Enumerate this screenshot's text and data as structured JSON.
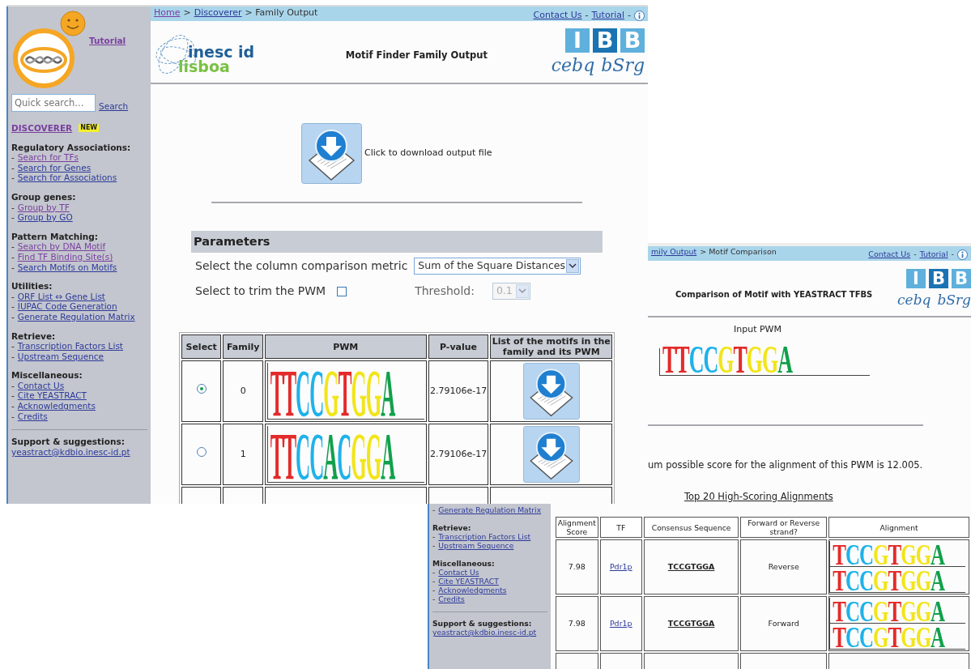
{
  "main_window": {
    "sidebar": {
      "tutorial_link": {
        "label": "Tutorial",
        "visited": true
      },
      "quick_search": {
        "placeholder": "Quick search...",
        "button": "Search"
      },
      "discoverer": {
        "label": "DISCOVERER",
        "visited": true,
        "badge": "NEW"
      },
      "sections": [
        {
          "heading": "Regulatory Associations:",
          "links": [
            {
              "bullet": "-",
              "label": "Search for TFs",
              "visited": true
            },
            {
              "bullet": "-",
              "label": "Search for Genes",
              "visited": false
            },
            {
              "bullet": "-",
              "label": "Search for Associations",
              "visited": false
            }
          ]
        },
        {
          "heading": "Group genes:",
          "links": [
            {
              "bullet": "-",
              "label": "Group by TF",
              "visited": true
            },
            {
              "bullet": "-",
              "label": "Group by GO",
              "visited": false
            }
          ]
        },
        {
          "heading": "Pattern Matching:",
          "links": [
            {
              "bullet": "-",
              "label": "Search by DNA Motif",
              "visited": true
            },
            {
              "bullet": "-",
              "label": "Find TF Binding Site(s)",
              "visited": true
            },
            {
              "bullet": "-",
              "label": "Search Motifs on Motifs",
              "visited": false
            }
          ]
        },
        {
          "heading": "Utilities:",
          "links": [
            {
              "bullet": "-",
              "label": "ORF List ⇔ Gene List",
              "visited": false
            },
            {
              "bullet": "-",
              "label": "IUPAC Code Generation",
              "visited": false
            },
            {
              "bullet": "-",
              "label": "Generate Regulation Matrix",
              "visited": false
            }
          ]
        },
        {
          "heading": "Retrieve:",
          "links": [
            {
              "bullet": "-",
              "label": "Transcription Factors List",
              "visited": false
            },
            {
              "bullet": "-",
              "label": "Upstream Sequence",
              "visited": false
            }
          ]
        },
        {
          "heading": "Miscellaneous:",
          "links": [
            {
              "bullet": "-",
              "label": "Contact Us",
              "visited": false
            },
            {
              "bullet": "-",
              "label": "Cite YEASTRACT",
              "visited": false
            },
            {
              "bullet": "-",
              "label": "Acknowledgments",
              "visited": false
            },
            {
              "bullet": "-",
              "label": "Credits",
              "visited": false
            }
          ]
        }
      ],
      "support": {
        "heading": "Support & suggestions:",
        "email": "yeastract@kdbio.inesc-id.pt"
      }
    },
    "nav_bar": {
      "breadcrumb": [
        {
          "kind": "link",
          "label": "Home",
          "visited": true
        },
        {
          "kind": "text",
          "label": ">"
        },
        {
          "kind": "link",
          "label": "Discoverer",
          "visited": false
        },
        {
          "kind": "text",
          "label": "> Family Output"
        }
      ],
      "links": [
        {
          "kind": "link",
          "label": "Contact Us",
          "visited": false
        },
        {
          "kind": "text",
          "label": "-"
        },
        {
          "kind": "link",
          "label": "Tutorial",
          "visited": false
        },
        {
          "kind": "text",
          "label": "-"
        },
        {
          "kind": "info"
        }
      ]
    },
    "header": {
      "inesc_logo": [
        "inesc id",
        "lisboa"
      ],
      "title": "Motif Finder Family Output",
      "ibb_logo": {
        "tiles": [
          "I",
          "B",
          "B"
        ],
        "words": [
          "cebq",
          "bSrg"
        ]
      }
    },
    "download": {
      "label": "Click to download output file"
    },
    "parameters": {
      "heading": "Parameters",
      "metric_label": "Select the column comparison metric",
      "metric_value": "Sum of the Square Distances",
      "trim_label": "Select to trim the PWM",
      "trim_checked": false,
      "threshold_label": "Threshold:",
      "threshold_value": "0.1",
      "threshold_disabled": true
    },
    "families_table": {
      "columns": [
        "Select",
        "Family",
        "PWM",
        "P-value",
        "List of the motifs in the family and its PWM"
      ],
      "rows": [
        {
          "selected": true,
          "family": "0",
          "p_value": "2.79106e-17",
          "pwm": [
            {
              "char": "T",
              "color": "#e42a2a"
            },
            {
              "char": "T",
              "color": "#e42a2a"
            },
            {
              "char": "C",
              "color": "#1eb2ea"
            },
            {
              "char": "C",
              "color": "#1eb2ea"
            },
            {
              "char": "G",
              "color": "#f2e51a"
            },
            {
              "char": "T",
              "color": "#e42a2a"
            },
            {
              "char": "G",
              "color": "#f2e51a"
            },
            {
              "char": "G",
              "color": "#f2e51a"
            },
            {
              "char": "A",
              "color": "#11a04b"
            }
          ]
        },
        {
          "selected": false,
          "family": "1",
          "p_value": "2.79106e-17",
          "pwm": [
            {
              "char": "T",
              "color": "#e42a2a"
            },
            {
              "char": "T",
              "color": "#e42a2a"
            },
            {
              "char": "C",
              "color": "#1eb2ea"
            },
            {
              "char": "C",
              "color": "#1eb2ea"
            },
            {
              "char": "A",
              "color": "#11a04b"
            },
            {
              "char": "C",
              "color": "#1eb2ea"
            },
            {
              "char": "G",
              "color": "#f2e51a"
            },
            {
              "char": "G",
              "color": "#f2e51a"
            },
            {
              "char": "A",
              "color": "#11a04b"
            }
          ]
        }
      ],
      "more_rows": true
    }
  },
  "comparison_window": {
    "nav_bar": {
      "breadcrumb": [
        {
          "kind": "link",
          "label": "mily Output",
          "visited": false
        },
        {
          "kind": "text",
          "label": "> Motif Comparison"
        }
      ],
      "links": [
        {
          "kind": "link",
          "label": "Contact Us",
          "visited": false
        },
        {
          "kind": "text",
          "label": "-"
        },
        {
          "kind": "link",
          "label": "Tutorial",
          "visited": false
        },
        {
          "kind": "text",
          "label": "-"
        },
        {
          "kind": "info"
        }
      ]
    },
    "title": "Comparison of Motif with YEASTRACT TFBS",
    "ibb_logo": {
      "tiles": [
        "I",
        "B",
        "B"
      ],
      "words": [
        "cebq",
        "bSrg"
      ]
    },
    "input_label": "Input PWM",
    "input_pwm": [
      {
        "char": "T",
        "color": "#e42a2a"
      },
      {
        "char": "T",
        "color": "#e42a2a"
      },
      {
        "char": "C",
        "color": "#1eb2ea"
      },
      {
        "char": "C",
        "color": "#1eb2ea"
      },
      {
        "char": "G",
        "color": "#f2e51a"
      },
      {
        "char": "T",
        "color": "#e42a2a"
      },
      {
        "char": "G",
        "color": "#f2e51a"
      },
      {
        "char": "G",
        "color": "#f2e51a"
      },
      {
        "char": "A",
        "color": "#11a04b"
      }
    ],
    "score_text": "um possible score for the alignment of this PWM is 12.005.",
    "alignments_link": "Top 20 High-Scoring Alignments"
  },
  "alignments_window": {
    "sidebar": {
      "sections": [
        {
          "links": [
            {
              "bullet": "-",
              "label": "Generate Regulation Matrix",
              "visited": false
            }
          ]
        },
        {
          "heading": "Retrieve:",
          "links": [
            {
              "bullet": "-",
              "label": "Transcription Factors List",
              "visited": false
            },
            {
              "bullet": "-",
              "label": "Upstream Sequence",
              "visited": false
            }
          ]
        },
        {
          "heading": "Miscellaneous:",
          "links": [
            {
              "bullet": "-",
              "label": "Contact Us",
              "visited": false
            },
            {
              "bullet": "-",
              "label": "Cite YEASTRACT",
              "visited": false
            },
            {
              "bullet": "-",
              "label": "Acknowledgments",
              "visited": false
            },
            {
              "bullet": "-",
              "label": "Credits",
              "visited": false
            }
          ]
        }
      ],
      "support": {
        "heading": "Support & suggestions:",
        "email": "yeastract@kdbio.inesc-id.pt"
      }
    },
    "table": {
      "columns": [
        "Alignment Score",
        "TF",
        "Consensus Sequence",
        "Forward or Reverse strand?",
        "Alignment"
      ],
      "rows": [
        {
          "score": "7.98",
          "tf": "Pdr1p",
          "consensus": "TCCGTGGA",
          "strand": "Reverse",
          "alignment": [
            [
              {
                "char": "T",
                "color": "#e42a2a"
              },
              {
                "char": "C",
                "color": "#1eb2ea"
              },
              {
                "char": "C",
                "color": "#1eb2ea"
              },
              {
                "char": "G",
                "color": "#f2e51a"
              },
              {
                "char": "T",
                "color": "#e42a2a"
              },
              {
                "char": "G",
                "color": "#f2e51a"
              },
              {
                "char": "G",
                "color": "#f2e51a"
              },
              {
                "char": "A",
                "color": "#11a04b"
              }
            ],
            [
              {
                "char": "T",
                "color": "#e42a2a"
              },
              {
                "char": "C",
                "color": "#1eb2ea"
              },
              {
                "char": "C",
                "color": "#1eb2ea"
              },
              {
                "char": "G",
                "color": "#f2e51a"
              },
              {
                "char": "T",
                "color": "#e42a2a"
              },
              {
                "char": "G",
                "color": "#f2e51a"
              },
              {
                "char": "G",
                "color": "#f2e51a"
              },
              {
                "char": "A",
                "color": "#11a04b"
              }
            ]
          ]
        },
        {
          "score": "7.98",
          "tf": "Pdr1p",
          "consensus": "TCCGTGGA",
          "strand": "Forward",
          "alignment": [
            [
              {
                "char": "T",
                "color": "#e42a2a"
              },
              {
                "char": "C",
                "color": "#1eb2ea"
              },
              {
                "char": "C",
                "color": "#1eb2ea"
              },
              {
                "char": "G",
                "color": "#f2e51a"
              },
              {
                "char": "T",
                "color": "#e42a2a"
              },
              {
                "char": "G",
                "color": "#f2e51a"
              },
              {
                "char": "G",
                "color": "#f2e51a"
              },
              {
                "char": "A",
                "color": "#11a04b"
              }
            ],
            [
              {
                "char": "T",
                "color": "#e42a2a"
              },
              {
                "char": "C",
                "color": "#1eb2ea"
              },
              {
                "char": "C",
                "color": "#1eb2ea"
              },
              {
                "char": "G",
                "color": "#f2e51a"
              },
              {
                "char": "T",
                "color": "#e42a2a"
              },
              {
                "char": "G",
                "color": "#f2e51a"
              },
              {
                "char": "G",
                "color": "#f2e51a"
              },
              {
                "char": "A",
                "color": "#11a04b"
              }
            ]
          ]
        }
      ],
      "more_rows": true
    }
  }
}
